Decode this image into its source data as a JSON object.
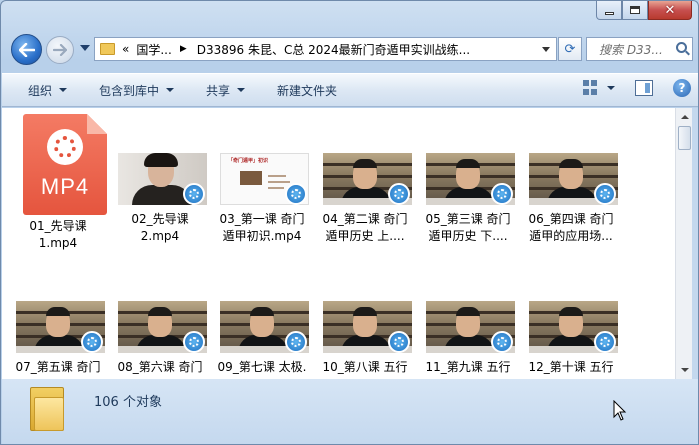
{
  "window": {
    "minimize": "minimize",
    "maximize": "maximize",
    "close": "close"
  },
  "nav": {
    "breadcrumb_prefix": "«",
    "crumbs": [
      "国学...",
      "D33896 朱昆、C总 2024最新门奇遁甲实训战练..."
    ],
    "search_placeholder": "搜索 D33..."
  },
  "toolbar": {
    "organize": "组织",
    "include_library": "包含到库中",
    "share": "共享",
    "new_folder": "新建文件夹"
  },
  "icons": {
    "back": "back-arrow-icon",
    "forward": "forward-arrow-icon",
    "refresh": "refresh-icon",
    "search": "search-icon",
    "view": "view-options-icon",
    "pane": "preview-pane-icon",
    "help": "help-icon",
    "video_badge": "video-player-badge-icon",
    "status_folder": "folder-icon"
  },
  "files": [
    {
      "line1": "01_先导课",
      "line2": "1.mp4",
      "kind": "mp4-icon",
      "mp4_text": "MP4"
    },
    {
      "line1": "02_先导课",
      "line2": "2.mp4",
      "kind": "girl"
    },
    {
      "line1": "03_第一课 奇门",
      "line2": "遁甲初识.mp4",
      "kind": "slide",
      "slide_title": "「奇门遁甲」初识"
    },
    {
      "line1": "04_第二课 奇门",
      "line2": "遁甲历史 上....",
      "kind": "video"
    },
    {
      "line1": "05_第三课 奇门",
      "line2": "遁甲历史 下....",
      "kind": "video"
    },
    {
      "line1": "06_第四课 奇门",
      "line2": "遁甲的应用场...",
      "kind": "video"
    },
    {
      "line1": "07_第五课 奇门",
      "line2": "",
      "kind": "video"
    },
    {
      "line1": "08_第六课 奇门",
      "line2": "",
      "kind": "video"
    },
    {
      "line1": "09_第七课 太极.",
      "line2": "",
      "kind": "video"
    },
    {
      "line1": "10_第八课 五行",
      "line2": "",
      "kind": "video"
    },
    {
      "line1": "11_第九课 五行",
      "line2": "",
      "kind": "video"
    },
    {
      "line1": "12_第十课 五行",
      "line2": "",
      "kind": "video"
    }
  ],
  "status": {
    "count": "106 个对象"
  }
}
